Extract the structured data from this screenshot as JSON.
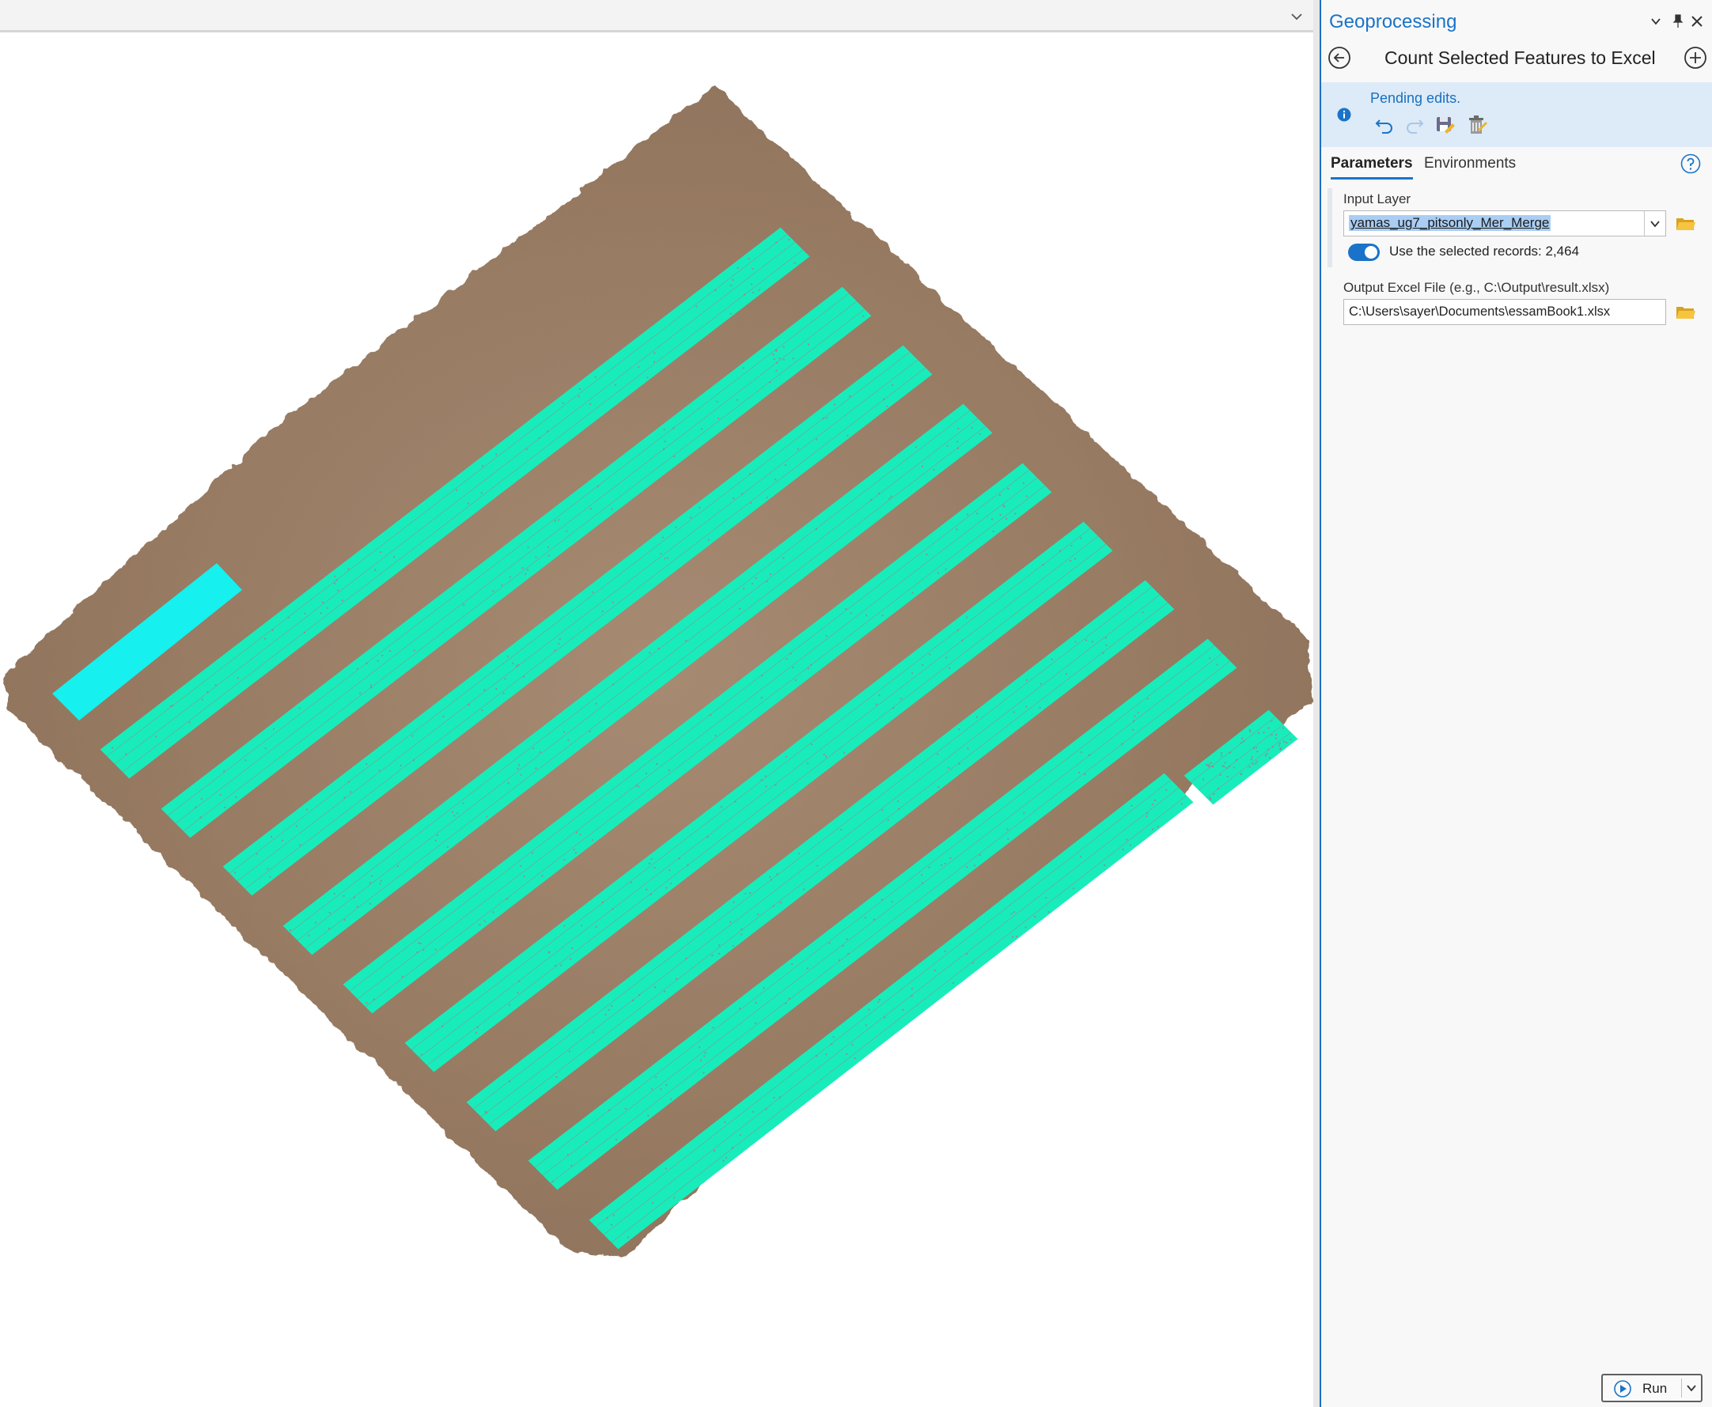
{
  "colors": {
    "accent": "#1a73c8",
    "pending_bg": "#dcebf7",
    "field_selection": "#a9cdf3",
    "ground": "#9c8068",
    "ground_dark": "#8a6e58",
    "rows": "#19ecbb",
    "rows_selected": "#16f0ee",
    "row_lines": "#d05a7a"
  },
  "map": {
    "description_icon": "chevron-down-icon"
  },
  "geoprocessing": {
    "title": "Geoprocessing",
    "header_controls": [
      "chevron-down-icon",
      "pin-icon",
      "close-icon"
    ],
    "tool_title": "Count Selected Features to Excel",
    "pending": {
      "message": "Pending edits.",
      "icons": [
        "undo-icon",
        "redo-icon",
        "save-edits-icon",
        "discard-edits-icon"
      ]
    },
    "tabs": {
      "parameters": "Parameters",
      "environments": "Environments"
    },
    "input_layer": {
      "label": "Input Layer",
      "value": "yamas_ug7_pitsonly_Mer_Merge",
      "use_selected": true,
      "use_selected_label": "Use the selected records: 2,464"
    },
    "output_file": {
      "label": "Output Excel File (e.g., C:\\Output\\result.xlsx)",
      "value": "C:\\Users\\sayer\\Documents\\essamBook1.xlsx"
    },
    "run_label": "Run"
  }
}
